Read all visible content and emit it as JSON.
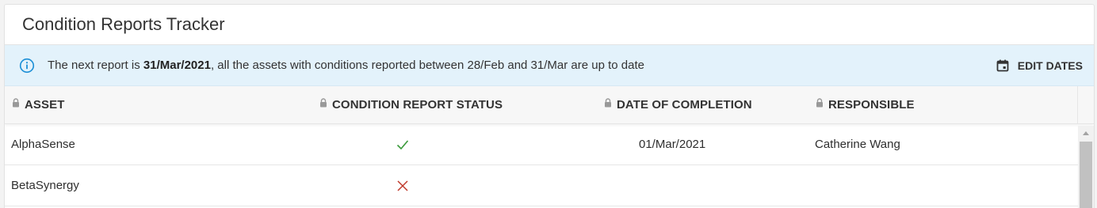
{
  "tracker": {
    "title": "Condition Reports Tracker"
  },
  "banner": {
    "text_before": "The next report is ",
    "next_date": "31/Mar/2021",
    "text_after": ", all the assets with conditions reported between 28/Feb and 31/Mar are up to date",
    "edit_label": "EDIT DATES",
    "icon": "info-icon",
    "edit_icon": "calendar-icon"
  },
  "table": {
    "columns": [
      {
        "label": "ASSET"
      },
      {
        "label": "CONDITION REPORT STATUS"
      },
      {
        "label": "DATE OF COMPLETION"
      },
      {
        "label": "RESPONSIBLE"
      }
    ],
    "rows": [
      {
        "asset": "AlphaSense",
        "status": "complete",
        "status_icon": "check-icon",
        "date": "01/Mar/2021",
        "responsible": "Catherine Wang"
      },
      {
        "asset": "BetaSynergy",
        "status": "incomplete",
        "status_icon": "cross-icon",
        "date": "",
        "responsible": ""
      }
    ]
  },
  "colors": {
    "accent": "#1c8fd6",
    "banner_bg": "#e3f2fb",
    "check": "#3a9a3a",
    "cross": "#c0392b"
  }
}
